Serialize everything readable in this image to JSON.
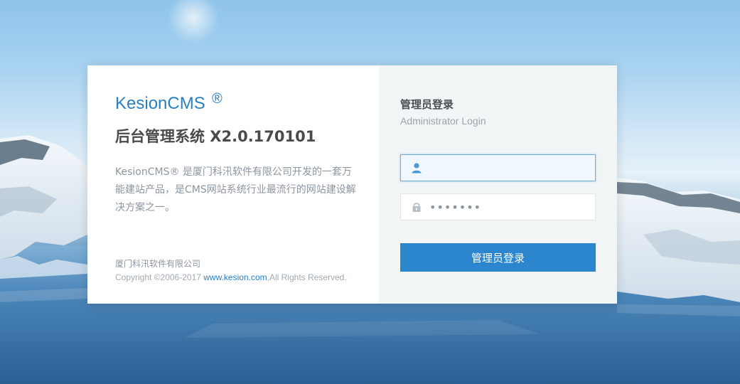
{
  "brand": {
    "name": "KesionCMS",
    "registered_mark": "®"
  },
  "system_title": "后台管理系统 X2.0.170101",
  "description": "KesionCMS® 是厦门科汛软件有限公司开发的一套万能建站产品，是CMS网站系统行业最流行的网站建设解决方案之一。",
  "footer": {
    "company": "厦门科汛软件有限公司",
    "copyright_prefix": "Copyright ©2006-2017 ",
    "site_link": "www.kesion.com",
    "copyright_suffix": ",All Rights Reserved."
  },
  "login": {
    "title": "管理员登录",
    "subtitle": "Administrator Login",
    "username": {
      "value": "",
      "placeholder": "",
      "icon": "user-icon"
    },
    "password": {
      "value": "•••••••",
      "placeholder": "",
      "icon": "lock-icon"
    },
    "submit_label": "管理员登录"
  },
  "colors": {
    "accent": "#2b86cd",
    "brand": "#2a7fc2",
    "right_panel": "#f2f5f6"
  }
}
